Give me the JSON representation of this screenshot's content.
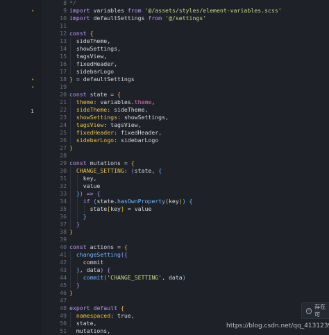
{
  "gutter": {
    "markers": [
      {
        "line": 9,
        "glyph": "•"
      },
      {
        "line": 18,
        "glyph": "•"
      },
      {
        "line": 19,
        "glyph": "•"
      }
    ],
    "focus_line": "1"
  },
  "editor": {
    "lines": [
      {
        "num": "8",
        "code": [
          {
            "t": "*/",
            "c": "com"
          }
        ]
      },
      {
        "num": "9",
        "code": [
          {
            "t": "import",
            "c": "kw"
          },
          {
            "t": " variables ",
            "c": "val"
          },
          {
            "t": "from",
            "c": "kw"
          },
          {
            "t": " ",
            "c": "val"
          },
          {
            "t": "'@/assets/styles/element-variables.scss'",
            "c": "str"
          }
        ]
      },
      {
        "num": "10",
        "code": [
          {
            "t": "import",
            "c": "kw"
          },
          {
            "t": " defaultSettings ",
            "c": "val"
          },
          {
            "t": "from",
            "c": "kw"
          },
          {
            "t": " ",
            "c": "val"
          },
          {
            "t": "'@/settings'",
            "c": "str"
          }
        ]
      },
      {
        "num": "11",
        "code": []
      },
      {
        "num": "12",
        "code": [
          {
            "t": "const",
            "c": "kw"
          },
          {
            "t": " ",
            "c": "val"
          },
          {
            "t": "{",
            "c": "br1"
          }
        ]
      },
      {
        "num": "13",
        "code": [
          {
            "t": "  sideTheme,",
            "c": "val"
          }
        ]
      },
      {
        "num": "14",
        "code": [
          {
            "t": "  showSettings,",
            "c": "val"
          }
        ]
      },
      {
        "num": "15",
        "code": [
          {
            "t": "  tagsView,",
            "c": "val"
          }
        ]
      },
      {
        "num": "16",
        "code": [
          {
            "t": "  fixedHeader,",
            "c": "val"
          }
        ]
      },
      {
        "num": "17",
        "code": [
          {
            "t": "  sidebarLogo",
            "c": "val"
          }
        ]
      },
      {
        "num": "18",
        "code": [
          {
            "t": "}",
            "c": "br1"
          },
          {
            "t": " = defaultSettings",
            "c": "val"
          }
        ]
      },
      {
        "num": "19",
        "code": []
      },
      {
        "num": "20",
        "code": [
          {
            "t": "const",
            "c": "kw"
          },
          {
            "t": " state = ",
            "c": "val"
          },
          {
            "t": "{",
            "c": "br1"
          }
        ]
      },
      {
        "num": "21",
        "code": [
          {
            "t": "  ",
            "c": "val"
          },
          {
            "t": "theme",
            "c": "br1"
          },
          {
            "t": ": variables.",
            "c": "val"
          },
          {
            "t": "theme",
            "c": "prop"
          },
          {
            "t": ",",
            "c": "val"
          }
        ]
      },
      {
        "num": "22",
        "code": [
          {
            "t": "  ",
            "c": "val"
          },
          {
            "t": "sideTheme",
            "c": "br1"
          },
          {
            "t": ": sideTheme,",
            "c": "val"
          }
        ]
      },
      {
        "num": "23",
        "code": [
          {
            "t": "  ",
            "c": "val"
          },
          {
            "t": "showSettings",
            "c": "br1"
          },
          {
            "t": ": showSettings,",
            "c": "val"
          }
        ]
      },
      {
        "num": "24",
        "code": [
          {
            "t": "  ",
            "c": "val"
          },
          {
            "t": "tagsView",
            "c": "br1"
          },
          {
            "t": ": tagsView,",
            "c": "val"
          }
        ]
      },
      {
        "num": "25",
        "code": [
          {
            "t": "  ",
            "c": "val"
          },
          {
            "t": "fixedHeader",
            "c": "br1"
          },
          {
            "t": ": fixedHeader,",
            "c": "val"
          }
        ]
      },
      {
        "num": "26",
        "code": [
          {
            "t": "  ",
            "c": "val"
          },
          {
            "t": "sidebarLogo",
            "c": "br1"
          },
          {
            "t": ": sidebarLogo",
            "c": "val"
          }
        ]
      },
      {
        "num": "27",
        "code": [
          {
            "t": "}",
            "c": "br1"
          }
        ]
      },
      {
        "num": "28",
        "code": []
      },
      {
        "num": "29",
        "code": [
          {
            "t": "const",
            "c": "kw"
          },
          {
            "t": " mutations = ",
            "c": "val"
          },
          {
            "t": "{",
            "c": "br1"
          }
        ]
      },
      {
        "num": "30",
        "code": [
          {
            "t": "  ",
            "c": "val"
          },
          {
            "t": "CHANGE_SETTING",
            "c": "br1"
          },
          {
            "t": ": ",
            "c": "val"
          },
          {
            "t": "(",
            "c": "br2"
          },
          {
            "t": "state, ",
            "c": "val"
          },
          {
            "t": "{",
            "c": "br3"
          }
        ]
      },
      {
        "num": "31",
        "code": [
          {
            "t": "    key,",
            "c": "val"
          }
        ]
      },
      {
        "num": "32",
        "code": [
          {
            "t": "    value",
            "c": "val"
          }
        ]
      },
      {
        "num": "33",
        "code": [
          {
            "t": "  ",
            "c": "val"
          },
          {
            "t": "}",
            "c": "br3"
          },
          {
            "t": ")",
            "c": "br2"
          },
          {
            "t": " => ",
            "c": "kw"
          },
          {
            "t": "{",
            "c": "br2"
          }
        ]
      },
      {
        "num": "34",
        "code": [
          {
            "t": "    ",
            "c": "val"
          },
          {
            "t": "if",
            "c": "kw"
          },
          {
            "t": " ",
            "c": "val"
          },
          {
            "t": "(",
            "c": "br3"
          },
          {
            "t": "state.",
            "c": "val"
          },
          {
            "t": "hasOwnProperty",
            "c": "fn"
          },
          {
            "t": "(",
            "c": "br1"
          },
          {
            "t": "key",
            "c": "val"
          },
          {
            "t": ")",
            "c": "br1"
          },
          {
            "t": ")",
            "c": "br3"
          },
          {
            "t": " ",
            "c": "val"
          },
          {
            "t": "{",
            "c": "br3"
          }
        ]
      },
      {
        "num": "35",
        "code": [
          {
            "t": "      state",
            "c": "val"
          },
          {
            "t": "[",
            "c": "br1"
          },
          {
            "t": "key",
            "c": "val"
          },
          {
            "t": "]",
            "c": "br1"
          },
          {
            "t": " = value",
            "c": "val"
          }
        ]
      },
      {
        "num": "36",
        "code": [
          {
            "t": "    ",
            "c": "val"
          },
          {
            "t": "}",
            "c": "br3"
          }
        ]
      },
      {
        "num": "37",
        "code": [
          {
            "t": "  ",
            "c": "val"
          },
          {
            "t": "}",
            "c": "br2"
          }
        ]
      },
      {
        "num": "38",
        "code": [
          {
            "t": "}",
            "c": "br1"
          }
        ]
      },
      {
        "num": "39",
        "code": []
      },
      {
        "num": "40",
        "code": [
          {
            "t": "const",
            "c": "kw"
          },
          {
            "t": " actions = ",
            "c": "val"
          },
          {
            "t": "{",
            "c": "br1"
          }
        ]
      },
      {
        "num": "41",
        "code": [
          {
            "t": "  ",
            "c": "val"
          },
          {
            "t": "changeSetting",
            "c": "fn"
          },
          {
            "t": "(",
            "c": "br2"
          },
          {
            "t": "{",
            "c": "br3"
          }
        ]
      },
      {
        "num": "42",
        "code": [
          {
            "t": "    commit",
            "c": "val"
          }
        ]
      },
      {
        "num": "43",
        "code": [
          {
            "t": "  ",
            "c": "val"
          },
          {
            "t": "}",
            "c": "br3"
          },
          {
            "t": ", data",
            "c": "val"
          },
          {
            "t": ")",
            "c": "br2"
          },
          {
            "t": " ",
            "c": "val"
          },
          {
            "t": "{",
            "c": "br2"
          }
        ]
      },
      {
        "num": "44",
        "code": [
          {
            "t": "    ",
            "c": "val"
          },
          {
            "t": "commit",
            "c": "fn"
          },
          {
            "t": "(",
            "c": "br3"
          },
          {
            "t": "'CHANGE_SETTING'",
            "c": "str"
          },
          {
            "t": ", data",
            "c": "val"
          },
          {
            "t": ")",
            "c": "br3"
          }
        ]
      },
      {
        "num": "45",
        "code": [
          {
            "t": "  ",
            "c": "val"
          },
          {
            "t": "}",
            "c": "br2"
          }
        ]
      },
      {
        "num": "46",
        "code": [
          {
            "t": "}",
            "c": "br1"
          }
        ]
      },
      {
        "num": "47",
        "code": []
      },
      {
        "num": "48",
        "code": [
          {
            "t": "export",
            "c": "kw"
          },
          {
            "t": " ",
            "c": "val"
          },
          {
            "t": "default",
            "c": "kw"
          },
          {
            "t": " ",
            "c": "val"
          },
          {
            "t": "{",
            "c": "br1"
          }
        ]
      },
      {
        "num": "49",
        "code": [
          {
            "t": "  ",
            "c": "val"
          },
          {
            "t": "namespaced",
            "c": "br1"
          },
          {
            "t": ": true,",
            "c": "val"
          }
        ]
      },
      {
        "num": "50",
        "code": [
          {
            "t": "  state,",
            "c": "val"
          }
        ]
      },
      {
        "num": "51",
        "code": [
          {
            "t": "  mutations,",
            "c": "val"
          }
        ]
      }
    ]
  },
  "toast": {
    "icon": "info-icon",
    "text": "存在可"
  },
  "watermark": {
    "text": "https://blog.csdn.net/qq_41312395"
  },
  "colors": {
    "background": "#1f2129",
    "keyword": "#b89af0",
    "string": "#c8d98a",
    "function": "#6fb6ff",
    "property": "#e26fb9",
    "bracket": "#e4c34d"
  }
}
